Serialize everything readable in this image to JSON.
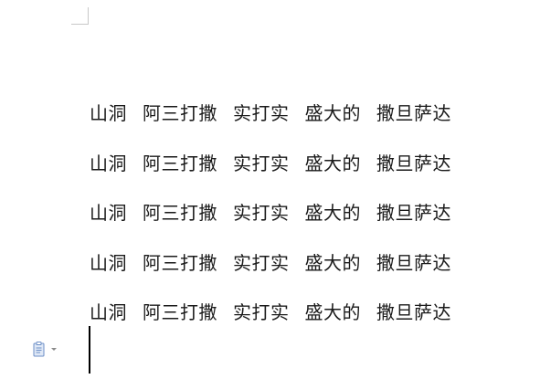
{
  "document": {
    "lines": [
      [
        "山洞",
        "阿三打撒",
        "实打实",
        "盛大的",
        "撒旦萨达"
      ],
      [
        "山洞",
        "阿三打撒",
        "实打实",
        "盛大的",
        "撒旦萨达"
      ],
      [
        "山洞",
        "阿三打撒",
        "实打实",
        "盛大的",
        "撒旦萨达"
      ],
      [
        "山洞",
        "阿三打撒",
        "实打实",
        "盛大的",
        "撒旦萨达"
      ],
      [
        "山洞",
        "阿三打撒",
        "实打实",
        "盛大的",
        "撒旦萨达"
      ]
    ]
  },
  "paste_options": {
    "icon": "paste-options-icon",
    "icon_color": "#6d8fc7"
  }
}
